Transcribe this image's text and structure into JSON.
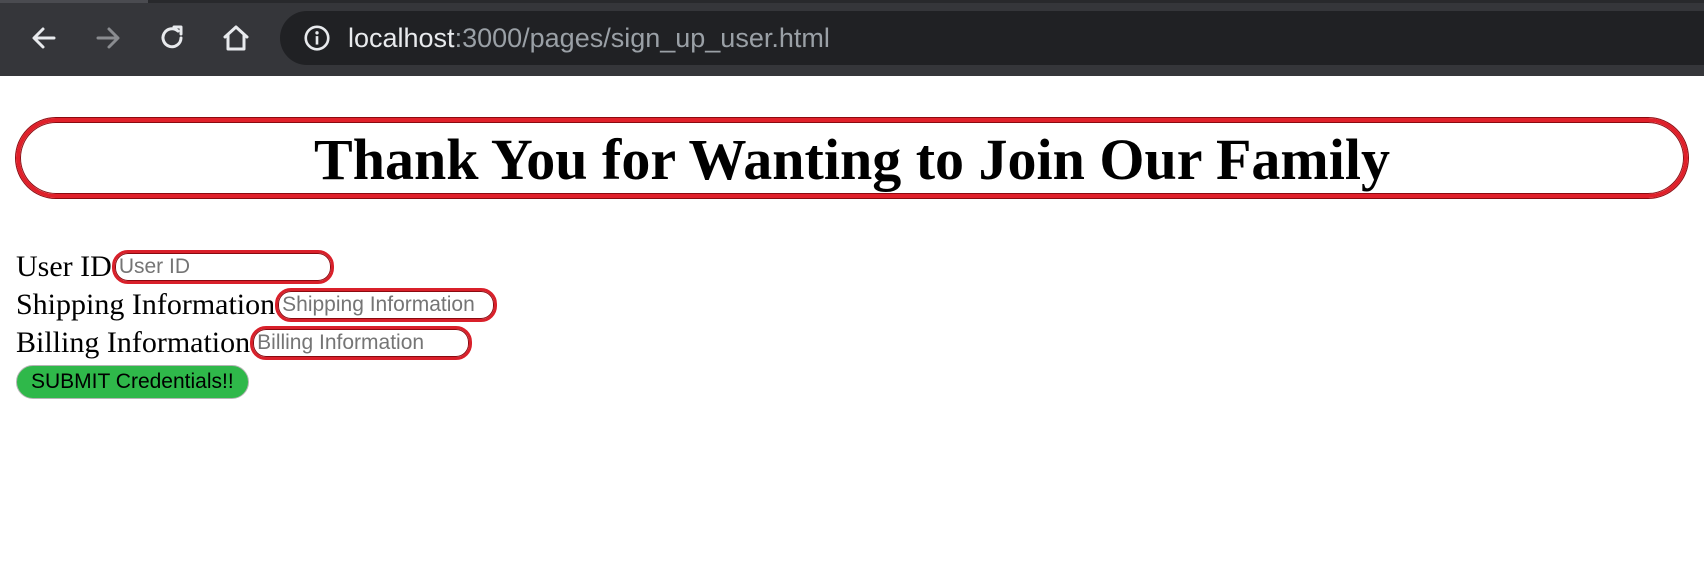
{
  "browser": {
    "url_host": "localhost",
    "url_path": ":3000/pages/sign_up_user.html",
    "icons": {
      "back": "arrow-left-icon",
      "forward": "arrow-right-icon",
      "reload": "reload-icon",
      "home": "home-icon",
      "site_info": "info-icon"
    }
  },
  "page": {
    "title": "Thank You for Wanting to Join Our Family",
    "form": {
      "fields": [
        {
          "label": "User ID",
          "placeholder": "User ID",
          "value": ""
        },
        {
          "label": "Shipping Information",
          "placeholder": "Shipping Information",
          "value": ""
        },
        {
          "label": "Billing Information",
          "placeholder": "Billing Information",
          "value": ""
        }
      ],
      "submit_label": "SUBMIT Credentials!!"
    },
    "colors": {
      "border_red": "#e0202a",
      "submit_green": "#2fb84a"
    }
  }
}
